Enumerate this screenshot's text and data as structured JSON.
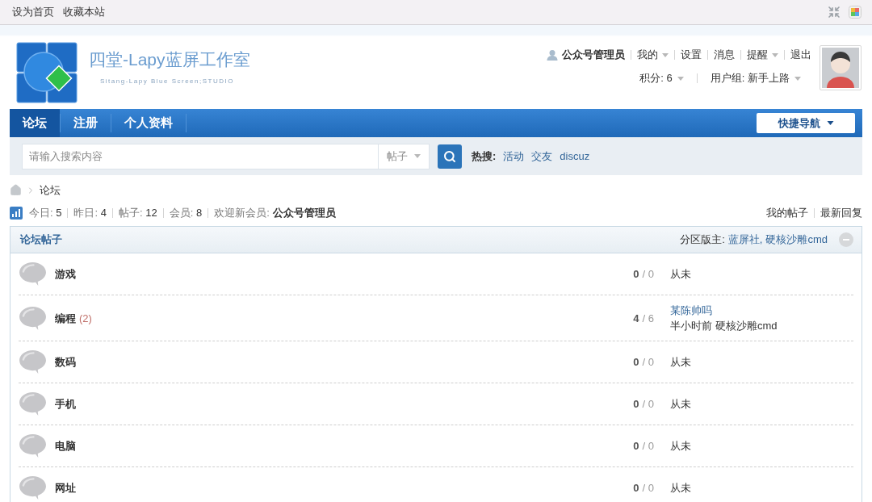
{
  "top_bar": {
    "links": [
      "设为首页",
      "收藏本站"
    ]
  },
  "header": {
    "logo": {
      "title": "四堂-Lapy蓝屏工作室",
      "subtitle": "Sitang-Lapy Blue Screen;STUDIO"
    },
    "user": {
      "name": "公众号管理员",
      "menu": [
        {
          "label": "我的",
          "has_menu": true
        },
        {
          "label": "设置",
          "has_menu": false
        },
        {
          "label": "消息",
          "has_menu": false
        },
        {
          "label": "提醒",
          "has_menu": true
        },
        {
          "label": "退出",
          "has_menu": false
        }
      ],
      "info": [
        {
          "label": "积分: 6",
          "has_menu": true
        },
        {
          "label": "用户组: 新手上路",
          "has_menu": true
        }
      ]
    }
  },
  "nav": {
    "tabs": [
      {
        "label": "论坛",
        "selected": true
      },
      {
        "label": "注册",
        "selected": false
      },
      {
        "label": "个人资料",
        "selected": false
      }
    ],
    "quick_nav": "快捷导航"
  },
  "search": {
    "placeholder": "请输入搜索内容",
    "type": "帖子",
    "hot_label": "热搜:",
    "hot": [
      "活动",
      "交友",
      "discuz"
    ]
  },
  "breadcrumb": [
    "论坛"
  ],
  "stats": {
    "items": [
      {
        "label": "今日:",
        "value": "5"
      },
      {
        "label": "昨日:",
        "value": "4"
      },
      {
        "label": "帖子:",
        "value": "12"
      },
      {
        "label": "会员:",
        "value": "8"
      }
    ],
    "welcome_label": "欢迎新会员:",
    "welcome_name": "公众号管理员",
    "links": [
      "我的帖子",
      "最新回复"
    ]
  },
  "forum": {
    "title": "论坛帖子",
    "moderators_label": "分区版主:",
    "moderators": [
      "蓝屏社,",
      "硬核沙雕cmd"
    ],
    "boards": [
      {
        "name": "游戏",
        "threads": "0",
        "posts": "/ 0",
        "last_post": {
          "kind": "never",
          "text": "从未"
        }
      },
      {
        "name": "编程",
        "today": "(2)",
        "threads": "4",
        "posts": "/ 6",
        "last_post": {
          "kind": "post",
          "title": "某陈帅吗",
          "time": "半小时前",
          "author": "硬核沙雕cmd"
        }
      },
      {
        "name": "数码",
        "threads": "0",
        "posts": "/ 0",
        "last_post": {
          "kind": "never",
          "text": "从未"
        }
      },
      {
        "name": "手机",
        "threads": "0",
        "posts": "/ 0",
        "last_post": {
          "kind": "never",
          "text": "从未"
        }
      },
      {
        "name": "电脑",
        "threads": "0",
        "posts": "/ 0",
        "last_post": {
          "kind": "never",
          "text": "从未"
        }
      },
      {
        "name": "网址",
        "threads": "0",
        "posts": "/ 0",
        "last_post": {
          "kind": "never",
          "text": "从未"
        }
      }
    ]
  }
}
